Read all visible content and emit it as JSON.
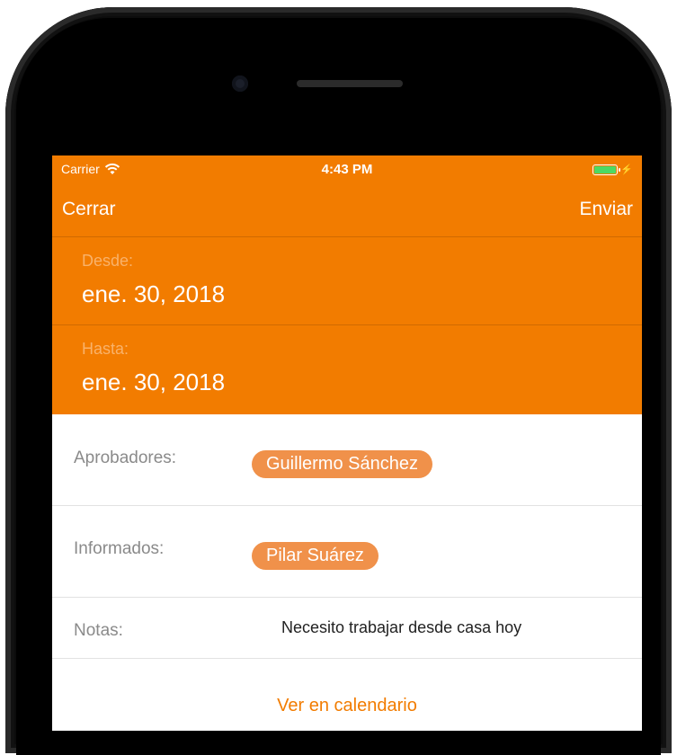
{
  "status_bar": {
    "carrier": "Carrier",
    "time": "4:43 PM"
  },
  "nav": {
    "close_label": "Cerrar",
    "send_label": "Enviar"
  },
  "dates": {
    "from_label": "Desde:",
    "from_value": "ene. 30, 2018",
    "to_label": "Hasta:",
    "to_value": "ene. 30, 2018"
  },
  "approvers": {
    "label": "Aprobadores:",
    "people": [
      "Guillermo Sánchez"
    ]
  },
  "informed": {
    "label": "Informados:",
    "people": [
      "Pilar Suárez"
    ]
  },
  "notes": {
    "label": "Notas:",
    "value": "Necesito trabajar desde casa hoy"
  },
  "calendar_link": "Ver en calendario",
  "colors": {
    "accent": "#f27c00",
    "chip": "#f0914a",
    "battery": "#4cd964"
  }
}
